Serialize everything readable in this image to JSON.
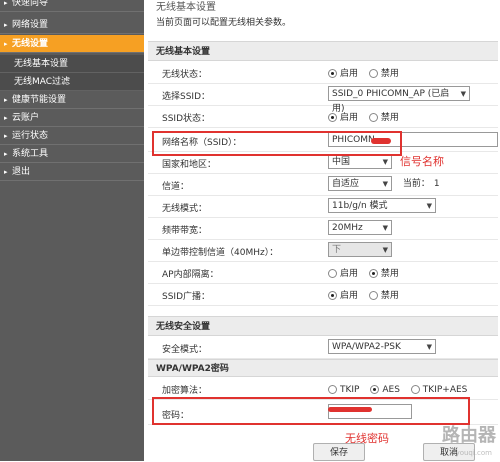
{
  "sidebar": {
    "items": [
      {
        "label": "快速向导"
      },
      {
        "label": "网络设置"
      },
      {
        "label": "无线设置",
        "active": true
      },
      {
        "label": "健康节能设置"
      },
      {
        "label": "云账户"
      },
      {
        "label": "运行状态"
      },
      {
        "label": "系统工具"
      },
      {
        "label": "退出"
      }
    ],
    "subitems": [
      {
        "label": "无线基本设置"
      },
      {
        "label": "无线MAC过滤"
      }
    ]
  },
  "header": {
    "title": "无线基本设置",
    "description": "当前页面可以配置无线相关参数。"
  },
  "basic": {
    "section_title": "无线基本设置",
    "wireless_status": {
      "label": "无线状态：",
      "options": [
        "启用",
        "禁用"
      ],
      "selected": "启用"
    },
    "select_ssid": {
      "label": "选择SSID：",
      "value": "SSID_0 PHICOMN_AP (已启用)"
    },
    "ssid_status": {
      "label": "SSID状态：",
      "options": [
        "启用",
        "禁用"
      ],
      "selected": "启用"
    },
    "ssid_name": {
      "label": "网络名称（SSID）：",
      "value": "PHICOMN"
    },
    "country": {
      "label": "国家和地区：",
      "value": "中国"
    },
    "channel": {
      "label": "信道：",
      "value": "自适应",
      "current_label": "当前：",
      "current_value": "1"
    },
    "mode": {
      "label": "无线模式：",
      "value": "11b/g/n 模式"
    },
    "bandwidth": {
      "label": "频带带宽：",
      "value": "20MHz"
    },
    "sideband": {
      "label": "单边带控制信道（40MHz）：",
      "value": "下"
    },
    "ap_isolation": {
      "label": "AP内部隔离：",
      "options": [
        "启用",
        "禁用"
      ],
      "selected": "禁用"
    },
    "ssid_broadcast": {
      "label": "SSID广播：",
      "options": [
        "启用",
        "禁用"
      ],
      "selected": "启用"
    }
  },
  "security": {
    "section_title": "无线安全设置",
    "mode": {
      "label": "安全模式：",
      "value": "WPA/WPA2-PSK"
    },
    "wpa_title": "WPA/WPA2密码",
    "cipher": {
      "label": "加密算法：",
      "options": [
        "TKIP",
        "AES",
        "TKIP+AES"
      ],
      "selected": "AES"
    },
    "password": {
      "label": "密码：",
      "value": ""
    }
  },
  "annotations": {
    "ssid_note": "信号名称",
    "password_note": "无线密码"
  },
  "buttons": {
    "save": "保存",
    "cancel": "取消"
  },
  "watermark": {
    "title": "路由器",
    "subtitle": "luyouqi.com"
  },
  "colors": {
    "accent": "#f6a023",
    "sidebar": "#5b5b5b",
    "annotation": "#e0322f"
  }
}
